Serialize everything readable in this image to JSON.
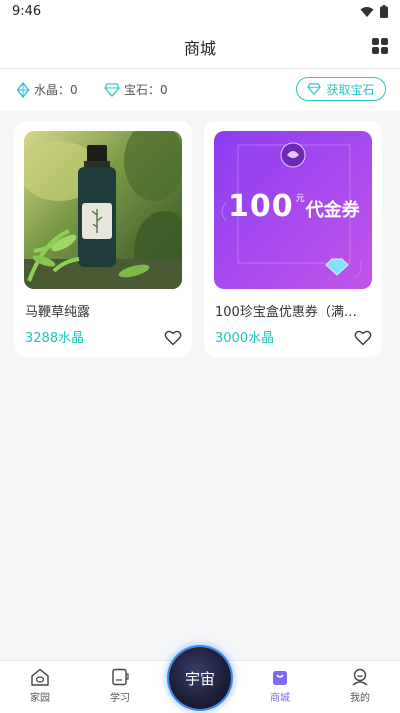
{
  "status": {
    "time": "9:46"
  },
  "header": {
    "title": "商城"
  },
  "balance": {
    "crystal_label": "水晶：0",
    "gem_label": "宝石：0",
    "get_gems": "获取宝石"
  },
  "products": [
    {
      "name": "马鞭草纯露",
      "price": "3288水晶"
    },
    {
      "name": "100珍宝盒优惠券（满…",
      "price": "3000水晶"
    }
  ],
  "voucher": {
    "amount": "100",
    "text": "代金券",
    "unit": "元"
  },
  "tabs": [
    {
      "label": "家园",
      "icon": "home-icon"
    },
    {
      "label": "学习",
      "icon": "book-icon"
    },
    {
      "label": "宇宙",
      "icon": "universe-orb"
    },
    {
      "label": "商城",
      "icon": "shop-bag-icon"
    },
    {
      "label": "我的",
      "icon": "profile-icon"
    }
  ],
  "colors": {
    "accent": "#22c3bd",
    "active_tab": "#7b6cf6"
  }
}
